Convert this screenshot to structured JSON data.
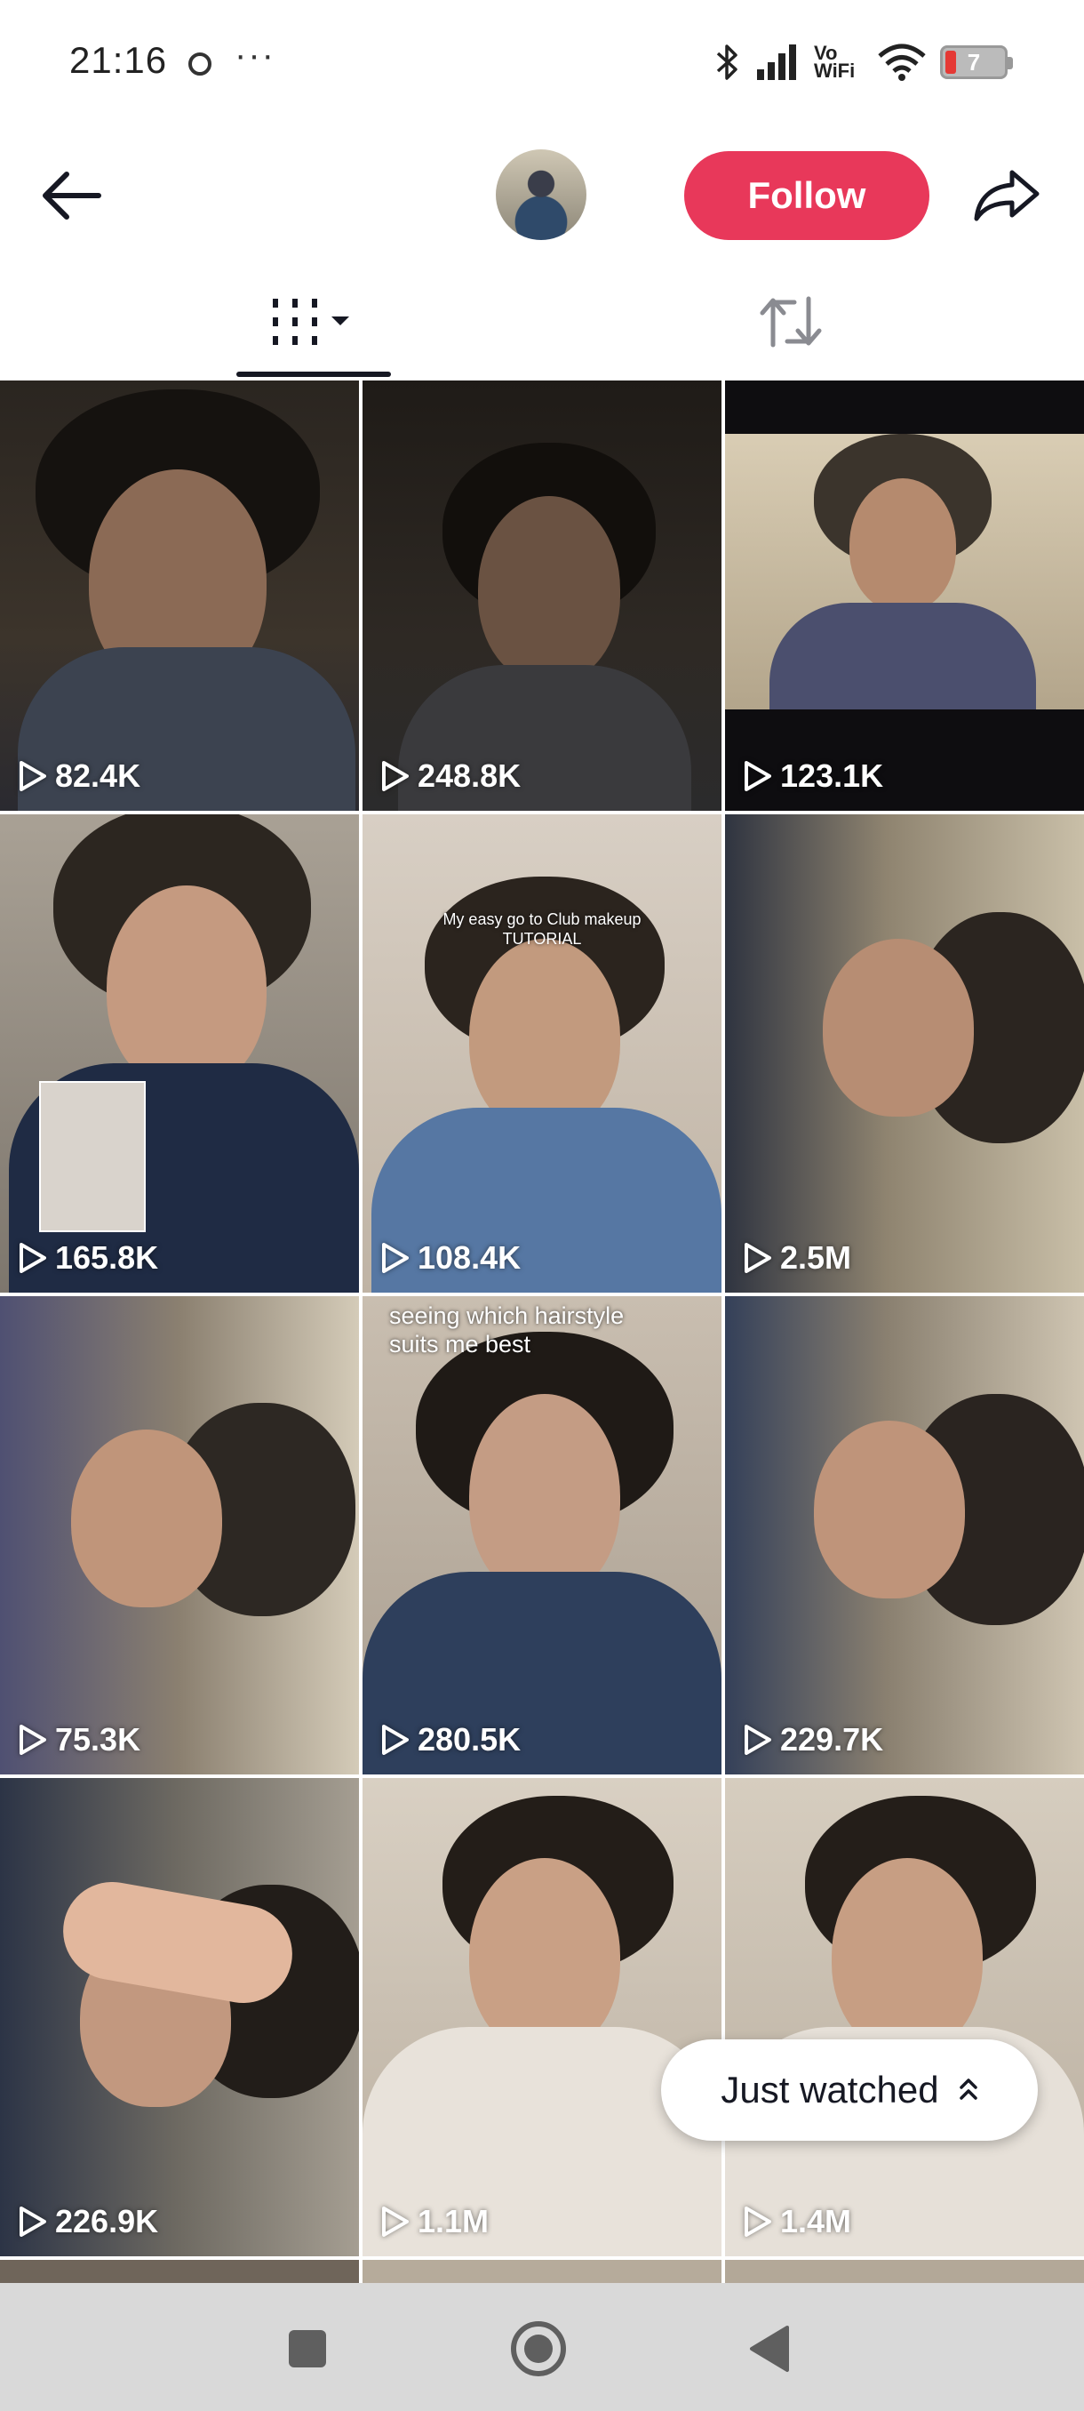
{
  "status_bar": {
    "time": "21:16",
    "more": "···",
    "vowifi": "Vo WiFi",
    "battery_level": "7",
    "battery_color": "#e53935"
  },
  "header": {
    "back_icon": "arrow-left-icon",
    "follow_label": "Follow",
    "follow_color": "#fe2c55",
    "share_icon": "share-arrow-icon"
  },
  "tabs": [
    {
      "icon": "videos-grid-icon",
      "selected": true
    },
    {
      "icon": "repost-icon",
      "selected": false
    }
  ],
  "videos": [
    {
      "views": "82.4K",
      "caption": ""
    },
    {
      "views": "248.8K",
      "caption": ""
    },
    {
      "views": "123.1K",
      "caption": ""
    },
    {
      "views": "165.8K",
      "caption": ""
    },
    {
      "views": "108.4K",
      "caption": "My easy go to Club makeup TUTORIAL"
    },
    {
      "views": "2.5M",
      "caption": ""
    },
    {
      "views": "75.3K",
      "caption": ""
    },
    {
      "views": "280.5K",
      "caption": "seeing which hairstyle suits me best"
    },
    {
      "views": "229.7K",
      "caption": ""
    },
    {
      "views": "226.9K",
      "caption": ""
    },
    {
      "views": "1.1M",
      "caption": ""
    },
    {
      "views": "1.4M",
      "caption": ""
    }
  ],
  "just_watched_label": "Just watched",
  "navbar": {
    "items": [
      "square-icon",
      "home-circle-icon",
      "back-triangle-icon"
    ]
  }
}
